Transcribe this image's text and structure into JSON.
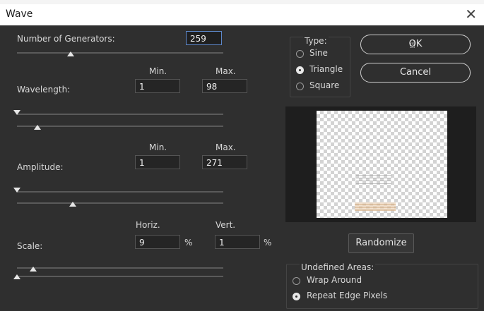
{
  "window": {
    "title": "Wave",
    "close_glyph": "✕"
  },
  "generators": {
    "label": "Number of Generators:",
    "value": "259",
    "slider_fraction": 0.26
  },
  "wavelength": {
    "label": "Wavelength:",
    "min_header": "Min.",
    "max_header": "Max.",
    "min": "1",
    "max": "98",
    "min_slider_fraction": 0.0,
    "max_slider_fraction": 0.1
  },
  "amplitude": {
    "label": "Amplitude:",
    "min_header": "Min.",
    "max_header": "Max.",
    "min": "1",
    "max": "271",
    "min_slider_fraction": 0.0,
    "max_slider_fraction": 0.27
  },
  "scale": {
    "label": "Scale:",
    "horiz_header": "Horiz.",
    "vert_header": "Vert.",
    "horiz": "9",
    "vert": "1",
    "unit": "%",
    "horiz_slider_fraction": 0.08,
    "vert_slider_fraction": 0.0
  },
  "type": {
    "legend": "Type:",
    "options": [
      "Sine",
      "Triangle",
      "Square"
    ],
    "selected": "Triangle"
  },
  "buttons": {
    "ok": "OK",
    "cancel": "Cancel",
    "randomize": "Randomize"
  },
  "undefined_areas": {
    "legend": "Undefined Areas:",
    "options": [
      "Wrap Around",
      "Repeat Edge Pixels"
    ],
    "selected": "Repeat Edge Pixels"
  },
  "icons": {
    "close": "close-icon",
    "cursor": "hand-cursor-icon"
  },
  "colors": {
    "panel": "#2f2f2f",
    "field_focus_border": "#5d87c9"
  }
}
